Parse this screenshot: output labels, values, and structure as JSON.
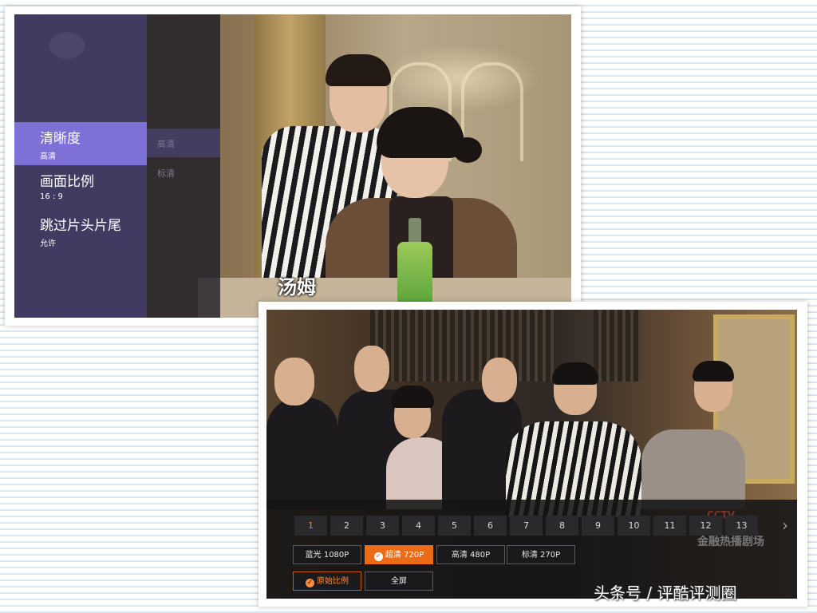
{
  "top_screen": {
    "subtitle": "汤姆",
    "settings_menu": [
      {
        "label": "清晰度",
        "value": "高清",
        "active": true
      },
      {
        "label": "画面比例",
        "value": "16 : 9",
        "active": false
      },
      {
        "label": "跳过片头片尾",
        "value": "允许",
        "active": false
      }
    ],
    "submenu": [
      {
        "label": "高清",
        "active": true
      },
      {
        "label": "标清",
        "active": false
      }
    ]
  },
  "bottom_screen": {
    "episodes": [
      "1",
      "2",
      "3",
      "4",
      "5",
      "6",
      "7",
      "8",
      "9",
      "10",
      "11",
      "12",
      "13"
    ],
    "current_episode": "1",
    "watermark": {
      "logo": "CCTV",
      "text": "金融热播剧场"
    },
    "quality_options": [
      {
        "label": "蓝光 1080P",
        "active": false
      },
      {
        "label": "超清 720P",
        "active": true
      },
      {
        "label": "高清 480P",
        "active": false
      },
      {
        "label": "标清 270P",
        "active": false
      }
    ],
    "aspect_options": [
      {
        "label": "原始比例",
        "active": true
      },
      {
        "label": "全屏",
        "active": false
      }
    ]
  },
  "credit": "头条号 / 评酷评测圈",
  "colors": {
    "menu_active": "#7d70d7",
    "menu_bg": "#3e3963",
    "option_active": "#ec6b16"
  }
}
